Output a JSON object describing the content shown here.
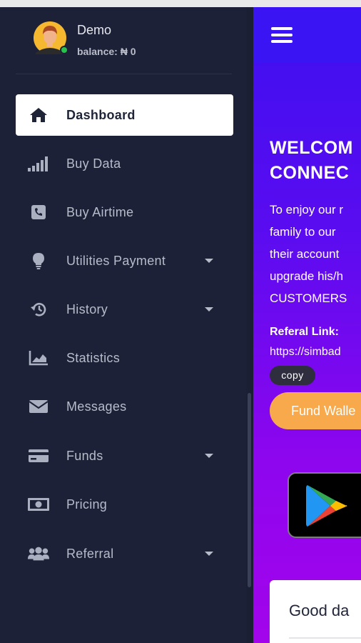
{
  "user": {
    "name": "Demo",
    "balance": "balance: ₦ 0"
  },
  "nav": {
    "items": [
      {
        "label": "Dashboard",
        "icon": "home-icon",
        "active": true,
        "has_submenu": false
      },
      {
        "label": "Buy Data",
        "icon": "signal-bars-icon",
        "active": false,
        "has_submenu": false
      },
      {
        "label": "Buy Airtime",
        "icon": "phone-icon",
        "active": false,
        "has_submenu": false
      },
      {
        "label": "Utilities Payment",
        "icon": "lightbulb-icon",
        "active": false,
        "has_submenu": true
      },
      {
        "label": "History",
        "icon": "history-icon",
        "active": false,
        "has_submenu": true
      },
      {
        "label": "Statistics",
        "icon": "chart-area-icon",
        "active": false,
        "has_submenu": false
      },
      {
        "label": "Messages",
        "icon": "envelope-icon",
        "active": false,
        "has_submenu": false
      },
      {
        "label": "Funds",
        "icon": "credit-card-icon",
        "active": false,
        "has_submenu": true
      },
      {
        "label": "Pricing",
        "icon": "money-bill-icon",
        "active": false,
        "has_submenu": false
      },
      {
        "label": "Referral",
        "icon": "users-icon",
        "active": false,
        "has_submenu": true
      }
    ]
  },
  "main": {
    "welcome_lines": [
      "WELCOM",
      "CONNEC"
    ],
    "intro_lines": [
      "To enjoy our r",
      "family to our",
      "their account",
      "upgrade his/h",
      "CUSTOMERS"
    ],
    "referral_title": "Referal Link:",
    "referral_link": "https://simbad",
    "copy_label": "copy",
    "fund_wallet_label": "Fund Walle",
    "card_title": "Good da"
  },
  "colors": {
    "sidebar_bg": "#1c2138",
    "header_bg": "#3a14f2",
    "gradient_top": "#3d10f0",
    "gradient_bottom": "#a304ec",
    "fund_button": "#f7a94c",
    "online_dot": "#27c24c"
  }
}
